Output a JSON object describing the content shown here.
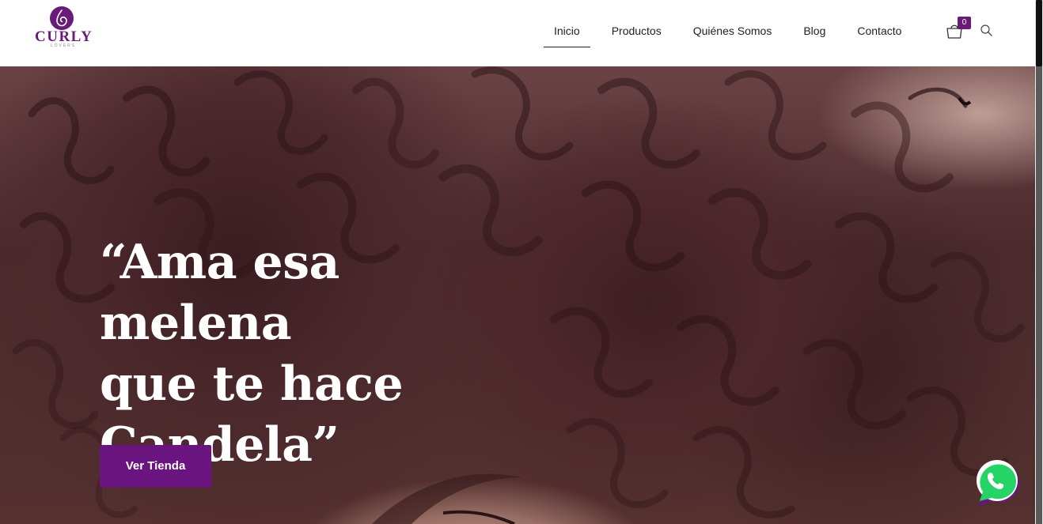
{
  "brand": {
    "name": "CURLY",
    "tagline": "LOVERS",
    "accent_color": "#6a1b7a"
  },
  "nav": {
    "items": [
      {
        "label": "Inicio",
        "active": true
      },
      {
        "label": "Productos",
        "active": false
      },
      {
        "label": "Quiénes Somos",
        "active": false
      },
      {
        "label": "Blog",
        "active": false
      },
      {
        "label": "Contacto",
        "active": false
      }
    ],
    "cart": {
      "icon": "shopping-bag-icon",
      "count": "0"
    },
    "search": {
      "icon": "search-icon"
    }
  },
  "hero": {
    "quote_line_1": "“Ama esa melena",
    "quote_line_2": "que te hace",
    "quote_line_3": "Candela”",
    "cta_label": "Ver Tienda",
    "cta_color": "#6a1480"
  },
  "floating": {
    "whatsapp_icon": "whatsapp-icon",
    "whatsapp_color": "#25d366"
  }
}
